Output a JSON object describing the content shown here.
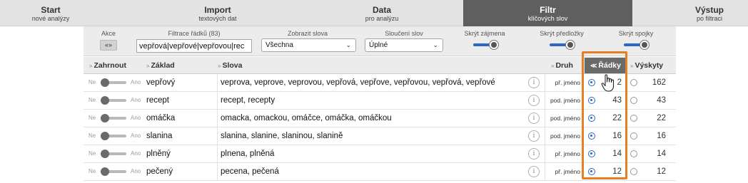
{
  "nav": {
    "steps": [
      {
        "title": "Start",
        "subtitle": "nové analýzy"
      },
      {
        "title": "Import",
        "subtitle": "textových dat"
      },
      {
        "title": "Data",
        "subtitle": "pro analýzu"
      },
      {
        "title": "Filtr",
        "subtitle": "klíčových slov"
      },
      {
        "title": "Výstup",
        "subtitle": "po filtraci"
      }
    ],
    "active_index": 3
  },
  "options": {
    "akce_label": "Akce",
    "akce_button": "«»",
    "filter_label": "Filtrace řádků (83)",
    "filter_value": "vepřová|vepřové|vepřovou|rec",
    "show_words_label": "Zobrazit slova",
    "show_words_value": "Všechna",
    "merge_label": "Sloučení slov",
    "merge_value": "Úplné",
    "hide_pronouns_label": "Skrýt zájmena",
    "hide_prepositions_label": "Skrýt předložky",
    "hide_conjunctions_label": "Skrýt spojky"
  },
  "table": {
    "headers": {
      "collapse": "Zahrnout",
      "base": "Základ",
      "forms": "Slova",
      "pos": "Druh",
      "rows": "Řádky",
      "occurrences": "Výskyty"
    },
    "toggle_no": "Ne",
    "toggle_yes": "Ano",
    "info_glyph": "i",
    "rows": [
      {
        "base": "vepřový",
        "forms": "veprova, veprove, veprovou, vepřová, vepřove, vepřovou, vepřová, vepřové",
        "pos": "př. jméno",
        "rows": "2",
        "occurrences": "162"
      },
      {
        "base": "recept",
        "forms": "recept, recepty",
        "pos": "pod. jméno",
        "rows": "43",
        "occurrences": "43"
      },
      {
        "base": "omáčka",
        "forms": "omacka, omackou, omáčce, omáčka, omáčkou",
        "pos": "pod. jméno",
        "rows": "22",
        "occurrences": "22"
      },
      {
        "base": "slanina",
        "forms": "slanina, slanine, slaninou, slanině",
        "pos": "pod. jméno",
        "rows": "16",
        "occurrences": "16"
      },
      {
        "base": "plněný",
        "forms": "plnena, plněná",
        "pos": "př. jméno",
        "rows": "14",
        "occurrences": "14"
      },
      {
        "base": "pečený",
        "forms": "pecena, pečená",
        "pos": "př. jméno",
        "rows": "12",
        "occurrences": "12"
      }
    ]
  },
  "colors": {
    "accent": "#2d66c4",
    "highlight": "#e67e22",
    "active_nav": "#5f5f5f"
  }
}
